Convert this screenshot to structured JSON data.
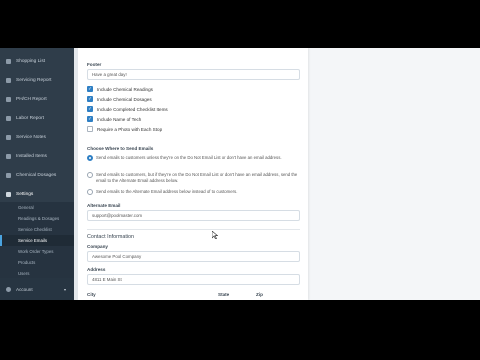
{
  "sidebar": {
    "items": [
      {
        "label": "Shopping List",
        "icon": "cart-icon"
      },
      {
        "label": "Servicing Report",
        "icon": "truck-icon"
      },
      {
        "label": "PH/CH Report",
        "icon": "clipboard-icon"
      },
      {
        "label": "Labor Report",
        "icon": "clock-icon"
      },
      {
        "label": "Service Notes",
        "icon": "note-icon"
      },
      {
        "label": "Installed Items",
        "icon": "box-icon"
      },
      {
        "label": "Chemical Dosages",
        "icon": "flask-icon"
      },
      {
        "label": "Settings",
        "icon": "gear-icon"
      }
    ],
    "subitems": [
      {
        "label": "General"
      },
      {
        "label": "Readings & Dosages"
      },
      {
        "label": "Service Checklist"
      },
      {
        "label": "Service Emails"
      },
      {
        "label": "Work Order Types"
      },
      {
        "label": "Products"
      },
      {
        "label": "Users"
      },
      {
        "label": "Export"
      }
    ],
    "account_label": "Account",
    "account_chevron": "▾"
  },
  "form": {
    "footer_label": "Footer",
    "footer_value": "Have a great day!",
    "checkboxes": [
      {
        "label": "Include Chemical Readings",
        "checked": true,
        "mark": "✓"
      },
      {
        "label": "Include Chemical Dosages",
        "checked": true,
        "mark": "✓"
      },
      {
        "label": "Include Completed Checklist Items",
        "checked": true,
        "mark": "✓"
      },
      {
        "label": "Include Name of Tech",
        "checked": true,
        "mark": "✓"
      },
      {
        "label": "Require a Photo with Each Stop",
        "checked": false,
        "mark": ""
      }
    ],
    "choose_label": "Choose Where to Send Emails",
    "radios": [
      {
        "label": "Send emails to customers unless they're on the Do Not Email List or don't have an email address.",
        "selected": true
      },
      {
        "label": "Send emails to customers, but if they're on the Do Not Email List or don't have an email address, send the email to the Alternate Email address below.",
        "selected": false
      },
      {
        "label": "Send emails to the Alternate Email address below instead of to customers.",
        "selected": false
      }
    ],
    "alt_email_label": "Alternate Email",
    "alt_email_value": "support@poolmaster.com",
    "contact_title": "Contact Information",
    "company_label": "Company",
    "company_value": "Awesome Pool Company",
    "address_label": "Address",
    "address_value": "4811 E Main St",
    "city_label": "City",
    "state_label": "State",
    "zip_label": "Zip"
  }
}
